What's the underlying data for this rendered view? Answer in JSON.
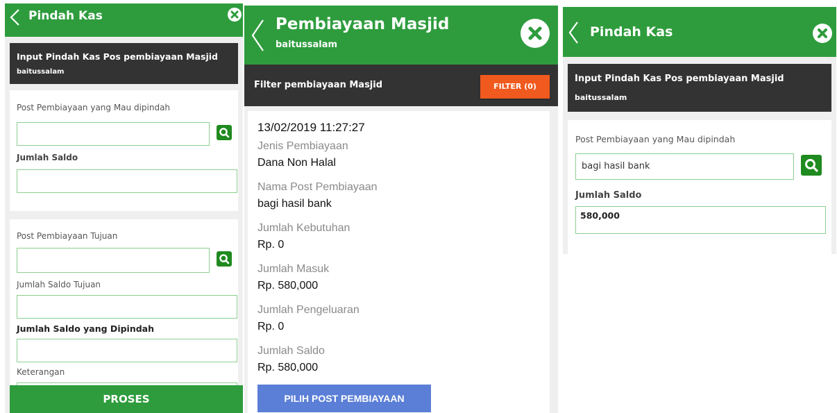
{
  "left": {
    "header_title": "Pindah Kas",
    "band_title": "Input Pindah Kas Pos pembiayaan Masjid",
    "band_subtitle": "baitussalam",
    "label_post_pindah": "Post Pembiayaan yang Mau dipindah",
    "label_jumlah_saldo": "Jumlah Saldo",
    "label_post_tujuan": "Post Pembiayaan Tujuan",
    "label_saldo_tujuan": "Jumlah Saldo Tujuan",
    "label_saldo_dipindah": "Jumlah Saldo yang Dipindah",
    "label_keterangan": "Keterangan",
    "proses_label": "PROSES"
  },
  "middle": {
    "header_title": "Pembiayaan Masjid",
    "header_subtitle": "baitussalam",
    "filter_label": "Filter pembiayaan Masjid",
    "filter_button": "FILTER (0)",
    "datetime": "13/02/2019 11:27:27",
    "jenis_label": "Jenis Pembiayaan",
    "jenis_value": "Dana Non Halal",
    "nama_label": "Nama Post Pembiayaan",
    "nama_value": "bagi hasil bank",
    "kebutuhan_label": "Jumlah Kebutuhan",
    "kebutuhan_value": "Rp. 0",
    "masuk_label": "Jumlah Masuk",
    "masuk_value": "Rp. 580,000",
    "pengeluaran_label": "Jumlah Pengeluaran",
    "pengeluaran_value": "Rp. 0",
    "saldo_label": "Jumlah Saldo",
    "saldo_value": "Rp. 580,000",
    "pilih_button": "PILIH POST PEMBIAYAAN"
  },
  "right": {
    "header_title": "Pindah Kas",
    "band_title": "Input Pindah Kas Pos pembiayaan Masjid",
    "band_subtitle": "baitussalam",
    "label_post_pindah": "Post Pembiayaan yang Mau dipindah",
    "post_pindah_value": "bagi hasil bank",
    "label_jumlah_saldo": "Jumlah Saldo",
    "jumlah_saldo_value": "580,000"
  },
  "colors": {
    "header_green": "#2e9c3d",
    "dark_band": "#333333",
    "filter_orange": "#f05a1e",
    "pilih_blue": "#5b7fd6",
    "search_green": "#1f8a1f"
  },
  "icons": {
    "back": "chevron-left-icon",
    "close": "close-icon",
    "search": "search-icon"
  }
}
